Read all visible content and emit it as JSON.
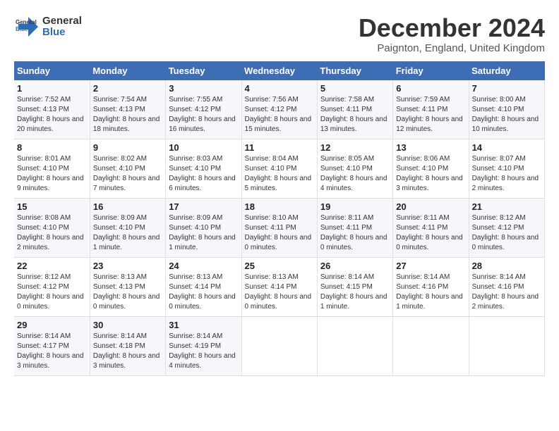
{
  "header": {
    "logo_line1": "General",
    "logo_line2": "Blue",
    "month_title": "December 2024",
    "location": "Paignton, England, United Kingdom"
  },
  "weekdays": [
    "Sunday",
    "Monday",
    "Tuesday",
    "Wednesday",
    "Thursday",
    "Friday",
    "Saturday"
  ],
  "weeks": [
    [
      {
        "day": "1",
        "sunrise": "7:52 AM",
        "sunset": "4:13 PM",
        "daylight": "8 hours and 20 minutes."
      },
      {
        "day": "2",
        "sunrise": "7:54 AM",
        "sunset": "4:13 PM",
        "daylight": "8 hours and 18 minutes."
      },
      {
        "day": "3",
        "sunrise": "7:55 AM",
        "sunset": "4:12 PM",
        "daylight": "8 hours and 16 minutes."
      },
      {
        "day": "4",
        "sunrise": "7:56 AM",
        "sunset": "4:12 PM",
        "daylight": "8 hours and 15 minutes."
      },
      {
        "day": "5",
        "sunrise": "7:58 AM",
        "sunset": "4:11 PM",
        "daylight": "8 hours and 13 minutes."
      },
      {
        "day": "6",
        "sunrise": "7:59 AM",
        "sunset": "4:11 PM",
        "daylight": "8 hours and 12 minutes."
      },
      {
        "day": "7",
        "sunrise": "8:00 AM",
        "sunset": "4:10 PM",
        "daylight": "8 hours and 10 minutes."
      }
    ],
    [
      {
        "day": "8",
        "sunrise": "8:01 AM",
        "sunset": "4:10 PM",
        "daylight": "8 hours and 9 minutes."
      },
      {
        "day": "9",
        "sunrise": "8:02 AM",
        "sunset": "4:10 PM",
        "daylight": "8 hours and 7 minutes."
      },
      {
        "day": "10",
        "sunrise": "8:03 AM",
        "sunset": "4:10 PM",
        "daylight": "8 hours and 6 minutes."
      },
      {
        "day": "11",
        "sunrise": "8:04 AM",
        "sunset": "4:10 PM",
        "daylight": "8 hours and 5 minutes."
      },
      {
        "day": "12",
        "sunrise": "8:05 AM",
        "sunset": "4:10 PM",
        "daylight": "8 hours and 4 minutes."
      },
      {
        "day": "13",
        "sunrise": "8:06 AM",
        "sunset": "4:10 PM",
        "daylight": "8 hours and 3 minutes."
      },
      {
        "day": "14",
        "sunrise": "8:07 AM",
        "sunset": "4:10 PM",
        "daylight": "8 hours and 2 minutes."
      }
    ],
    [
      {
        "day": "15",
        "sunrise": "8:08 AM",
        "sunset": "4:10 PM",
        "daylight": "8 hours and 2 minutes."
      },
      {
        "day": "16",
        "sunrise": "8:09 AM",
        "sunset": "4:10 PM",
        "daylight": "8 hours and 1 minute."
      },
      {
        "day": "17",
        "sunrise": "8:09 AM",
        "sunset": "4:10 PM",
        "daylight": "8 hours and 1 minute."
      },
      {
        "day": "18",
        "sunrise": "8:10 AM",
        "sunset": "4:11 PM",
        "daylight": "8 hours and 0 minutes."
      },
      {
        "day": "19",
        "sunrise": "8:11 AM",
        "sunset": "4:11 PM",
        "daylight": "8 hours and 0 minutes."
      },
      {
        "day": "20",
        "sunrise": "8:11 AM",
        "sunset": "4:11 PM",
        "daylight": "8 hours and 0 minutes."
      },
      {
        "day": "21",
        "sunrise": "8:12 AM",
        "sunset": "4:12 PM",
        "daylight": "8 hours and 0 minutes."
      }
    ],
    [
      {
        "day": "22",
        "sunrise": "8:12 AM",
        "sunset": "4:12 PM",
        "daylight": "8 hours and 0 minutes."
      },
      {
        "day": "23",
        "sunrise": "8:13 AM",
        "sunset": "4:13 PM",
        "daylight": "8 hours and 0 minutes."
      },
      {
        "day": "24",
        "sunrise": "8:13 AM",
        "sunset": "4:14 PM",
        "daylight": "8 hours and 0 minutes."
      },
      {
        "day": "25",
        "sunrise": "8:13 AM",
        "sunset": "4:14 PM",
        "daylight": "8 hours and 0 minutes."
      },
      {
        "day": "26",
        "sunrise": "8:14 AM",
        "sunset": "4:15 PM",
        "daylight": "8 hours and 1 minute."
      },
      {
        "day": "27",
        "sunrise": "8:14 AM",
        "sunset": "4:16 PM",
        "daylight": "8 hours and 1 minute."
      },
      {
        "day": "28",
        "sunrise": "8:14 AM",
        "sunset": "4:16 PM",
        "daylight": "8 hours and 2 minutes."
      }
    ],
    [
      {
        "day": "29",
        "sunrise": "8:14 AM",
        "sunset": "4:17 PM",
        "daylight": "8 hours and 3 minutes."
      },
      {
        "day": "30",
        "sunrise": "8:14 AM",
        "sunset": "4:18 PM",
        "daylight": "8 hours and 3 minutes."
      },
      {
        "day": "31",
        "sunrise": "8:14 AM",
        "sunset": "4:19 PM",
        "daylight": "8 hours and 4 minutes."
      },
      null,
      null,
      null,
      null
    ]
  ],
  "labels": {
    "sunrise": "Sunrise:",
    "sunset": "Sunset:",
    "daylight": "Daylight:"
  }
}
